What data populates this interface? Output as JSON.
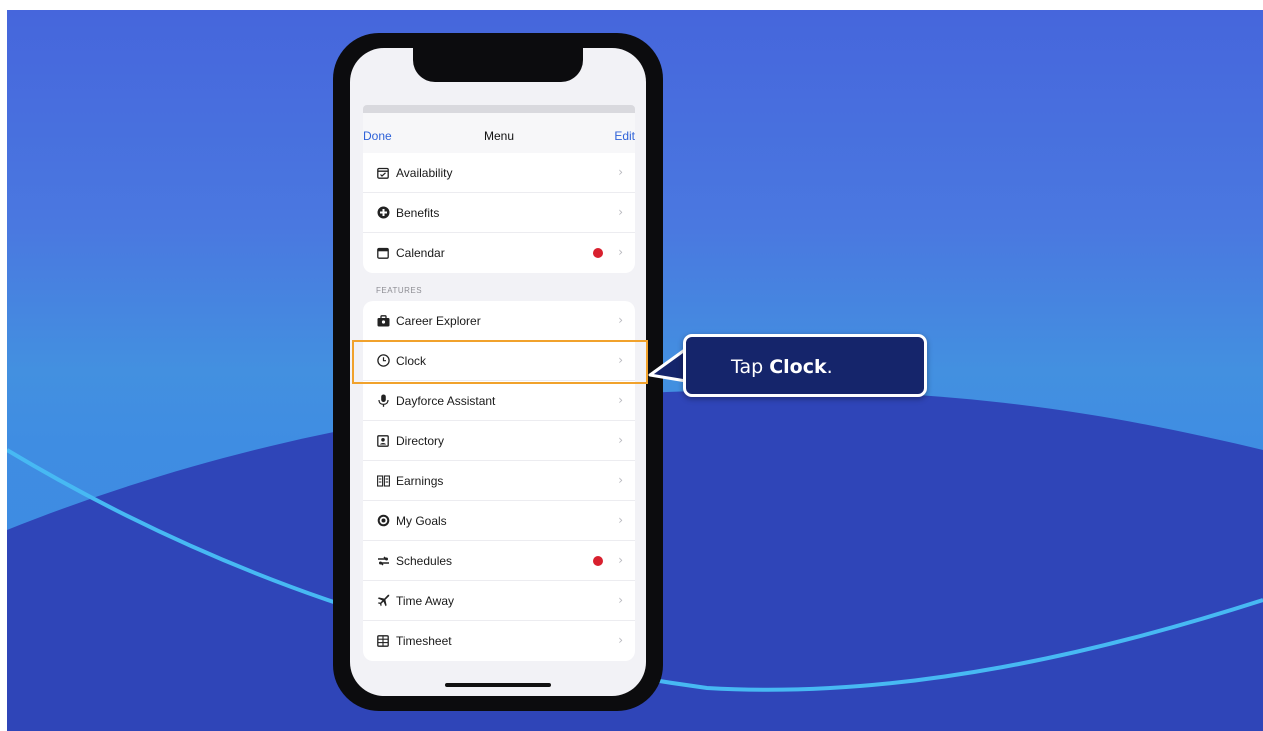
{
  "navbar": {
    "done_label": "Done",
    "title": "Menu",
    "edit_label": "Edit"
  },
  "top_items": [
    {
      "label": "Availability",
      "icon": "availability-icon",
      "has_dot": false
    },
    {
      "label": "Benefits",
      "icon": "benefits-icon",
      "has_dot": false
    },
    {
      "label": "Calendar",
      "icon": "calendar-icon",
      "has_dot": true
    }
  ],
  "features_header": "FEATURES",
  "feature_items": [
    {
      "label": "Career Explorer",
      "icon": "briefcase-icon",
      "has_dot": false
    },
    {
      "label": "Clock",
      "icon": "clock-icon",
      "has_dot": false
    },
    {
      "label": "Dayforce Assistant",
      "icon": "microphone-icon",
      "has_dot": false
    },
    {
      "label": "Directory",
      "icon": "directory-icon",
      "has_dot": false
    },
    {
      "label": "Earnings",
      "icon": "earnings-icon",
      "has_dot": false
    },
    {
      "label": "My Goals",
      "icon": "goals-icon",
      "has_dot": false
    },
    {
      "label": "Schedules",
      "icon": "schedules-icon",
      "has_dot": true
    },
    {
      "label": "Time Away",
      "icon": "airplane-icon",
      "has_dot": false
    },
    {
      "label": "Timesheet",
      "icon": "timesheet-icon",
      "has_dot": false
    }
  ],
  "callout": {
    "prefix": "Tap ",
    "bold": "Clock",
    "suffix": "."
  },
  "colors": {
    "accent": "#2f62d8",
    "badge": "#d8202e",
    "highlight": "#f1a22c",
    "callout_bg": "#15256b"
  }
}
